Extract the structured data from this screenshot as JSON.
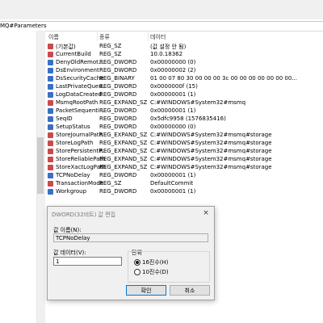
{
  "address": "MQ#Parameters",
  "columns": {
    "name": "이름",
    "type": "종류",
    "data": "데이터"
  },
  "rows": [
    {
      "name": "(기본값)",
      "type": "REG_SZ",
      "data": "(값 설정 안 됨)",
      "icon": "string-value-icon"
    },
    {
      "name": "CurrentBuild",
      "type": "REG_SZ",
      "data": "10.0.18362",
      "icon": "string-value-icon"
    },
    {
      "name": "DenyOldRemot...",
      "type": "REG_DWORD",
      "data": "0x00000000 (0)",
      "icon": "binary-value-icon"
    },
    {
      "name": "DsEnvironment",
      "type": "REG_DWORD",
      "data": "0x00000002 (2)",
      "icon": "binary-value-icon"
    },
    {
      "name": "DsSecurityCache",
      "type": "REG_BINARY",
      "data": "01 00 07 80 30 00 00 00 3c 00 00 00 00 00 00 00...",
      "icon": "binary-value-icon"
    },
    {
      "name": "LastPrivateQueu...",
      "type": "REG_DWORD",
      "data": "0x0000000f (15)",
      "icon": "binary-value-icon"
    },
    {
      "name": "LogDataCreated",
      "type": "REG_DWORD",
      "data": "0x00000001 (1)",
      "icon": "binary-value-icon"
    },
    {
      "name": "MsmqRootPath",
      "type": "REG_EXPAND_SZ",
      "data": "C:#WINDOWS#System32#msmq",
      "icon": "string-value-icon"
    },
    {
      "name": "PacketSequenti...",
      "type": "REG_DWORD",
      "data": "0x00000001 (1)",
      "icon": "binary-value-icon"
    },
    {
      "name": "SeqID",
      "type": "REG_DWORD",
      "data": "0x5dfc9958 (1576835416)",
      "icon": "binary-value-icon"
    },
    {
      "name": "SetupStatus",
      "type": "REG_DWORD",
      "data": "0x00000000 (0)",
      "icon": "binary-value-icon"
    },
    {
      "name": "StoreJournalPath",
      "type": "REG_EXPAND_SZ",
      "data": "C:#WINDOWS#System32#msmq#storage",
      "icon": "string-value-icon"
    },
    {
      "name": "StoreLogPath",
      "type": "REG_EXPAND_SZ",
      "data": "C:#WINDOWS#System32#msmq#storage",
      "icon": "string-value-icon"
    },
    {
      "name": "StorePersistentP...",
      "type": "REG_EXPAND_SZ",
      "data": "C:#WINDOWS#System32#msmq#storage",
      "icon": "string-value-icon"
    },
    {
      "name": "StoreReliablePath",
      "type": "REG_EXPAND_SZ",
      "data": "C:#WINDOWS#System32#msmq#storage",
      "icon": "string-value-icon"
    },
    {
      "name": "StoreXactLogPath",
      "type": "REG_EXPAND_SZ",
      "data": "C:#WINDOWS#System32#msmq#storage",
      "icon": "string-value-icon"
    },
    {
      "name": "TCPNoDelay",
      "type": "REG_DWORD",
      "data": "0x00000001 (1)",
      "icon": "binary-value-icon"
    },
    {
      "name": "TransactionMode",
      "type": "REG_SZ",
      "data": "DefaultCommit",
      "icon": "string-value-icon"
    },
    {
      "name": "Workgroup",
      "type": "REG_DWORD",
      "data": "0x00000001 (1)",
      "icon": "binary-value-icon"
    }
  ],
  "dialog": {
    "title": "DWORD(32비트) 값 편집",
    "close": "×",
    "name_label": "값 이름(N):",
    "name_value": "TCPNoDelay",
    "data_label": "값 데이터(V):",
    "data_value": "1",
    "base_label": "단위",
    "hex_label": "16진수(H)",
    "dec_label": "10진수(D)",
    "ok": "확인",
    "cancel": "취소",
    "base_selected": "hex"
  },
  "colors": {
    "string_icon": "#c94b4b",
    "binary_icon": "#3b6fc4",
    "accent": "#0078d7"
  }
}
